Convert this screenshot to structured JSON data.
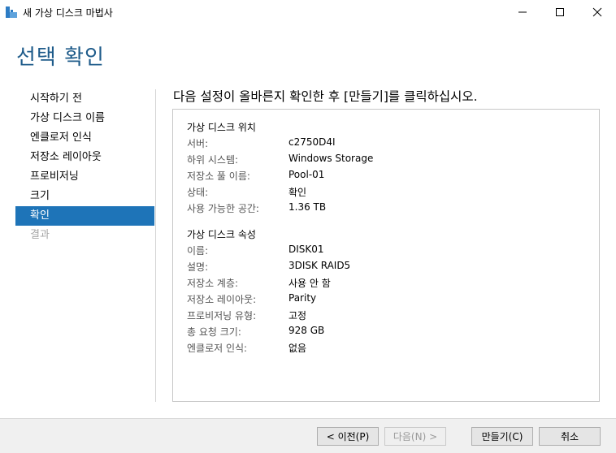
{
  "window": {
    "title": "새 가상 디스크 마법사",
    "icon": "virtual-disk-wizard-icon"
  },
  "page": {
    "title": "선택 확인",
    "instruction": "다음 설정이 올바른지 확인한 후 [만들기]를 클릭하십시오."
  },
  "nav": {
    "items": [
      {
        "label": "시작하기 전",
        "state": "normal"
      },
      {
        "label": "가상 디스크 이름",
        "state": "normal"
      },
      {
        "label": "엔클로저 인식",
        "state": "normal"
      },
      {
        "label": "저장소 레이아웃",
        "state": "normal"
      },
      {
        "label": "프로비저닝",
        "state": "normal"
      },
      {
        "label": "크기",
        "state": "normal"
      },
      {
        "label": "확인",
        "state": "active"
      },
      {
        "label": "결과",
        "state": "disabled"
      }
    ]
  },
  "location": {
    "heading": "가상 디스크 위치",
    "rows": [
      {
        "label": "서버:",
        "value": "c2750D4I"
      },
      {
        "label": "하위 시스템:",
        "value": "Windows Storage"
      },
      {
        "label": "저장소 풀 이름:",
        "value": "Pool-01"
      },
      {
        "label": "상태:",
        "value": "확인"
      },
      {
        "label": "사용 가능한 공간:",
        "value": "1.36 TB"
      }
    ]
  },
  "properties": {
    "heading": "가상 디스크 속성",
    "rows": [
      {
        "label": "이름:",
        "value": "DISK01"
      },
      {
        "label": "설명:",
        "value": "3DISK RAID5"
      },
      {
        "label": "저장소 계층:",
        "value": "사용 안 함"
      },
      {
        "label": "저장소 레이아웃:",
        "value": "Parity"
      },
      {
        "label": "프로비저닝 유형:",
        "value": "고정"
      },
      {
        "label": "총 요청 크기:",
        "value": "928 GB"
      },
      {
        "label": "엔클로저 인식:",
        "value": "없음"
      }
    ]
  },
  "footer": {
    "prev_label": "< 이전(P)",
    "next_label": "다음(N) >",
    "create_label": "만들기(C)",
    "cancel_label": "취소"
  },
  "colors": {
    "accent": "#1e74b8",
    "title": "#1e5b8a"
  }
}
